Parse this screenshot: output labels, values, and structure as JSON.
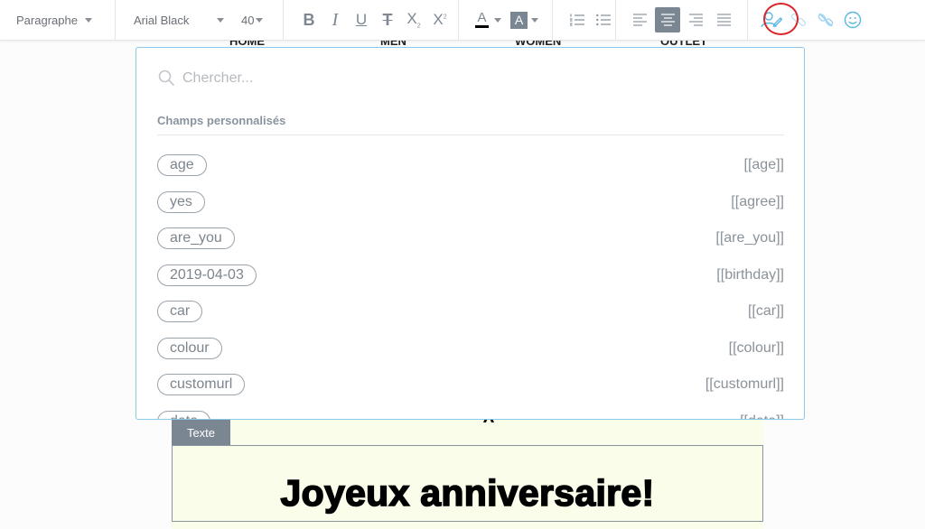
{
  "toolbar": {
    "paragraph_style": "Paragraphe",
    "font_family": "Arial Black",
    "font_size": "40",
    "format_buttons": [
      {
        "name": "bold",
        "label": "B"
      },
      {
        "name": "italic",
        "label": "I"
      },
      {
        "name": "underline",
        "label": "U"
      },
      {
        "name": "strikethrough",
        "label": "T"
      },
      {
        "name": "subscript",
        "label": "X"
      },
      {
        "name": "superscript",
        "label": "X"
      }
    ],
    "text_color_label": "A",
    "highlight_color_label": "A",
    "text_color": "#000000",
    "highlight_color": "#7a8793",
    "alignment_active": "center",
    "accent_color": "#5ab6e4",
    "highlight_ring_color": "#d9262c"
  },
  "nav": [
    "HOME",
    "MEN",
    "WOMEN",
    "OUTLET"
  ],
  "popup": {
    "search_placeholder": "Chercher...",
    "section_title": "Champs personnalisés",
    "fields": [
      {
        "value": "age",
        "tag": "[[age]]"
      },
      {
        "value": "yes",
        "tag": "[[agree]]"
      },
      {
        "value": "are_you",
        "tag": "[[are_you]]"
      },
      {
        "value": "2019-04-03",
        "tag": "[[birthday]]"
      },
      {
        "value": "car",
        "tag": "[[car]]"
      },
      {
        "value": "colour",
        "tag": "[[colour]]"
      },
      {
        "value": "customurl",
        "tag": "[[customurl]]"
      },
      {
        "value": "data",
        "tag": "[[data]]"
      }
    ]
  },
  "editor": {
    "block_label": "Texte",
    "content": "Joyeux anniversaire!"
  }
}
